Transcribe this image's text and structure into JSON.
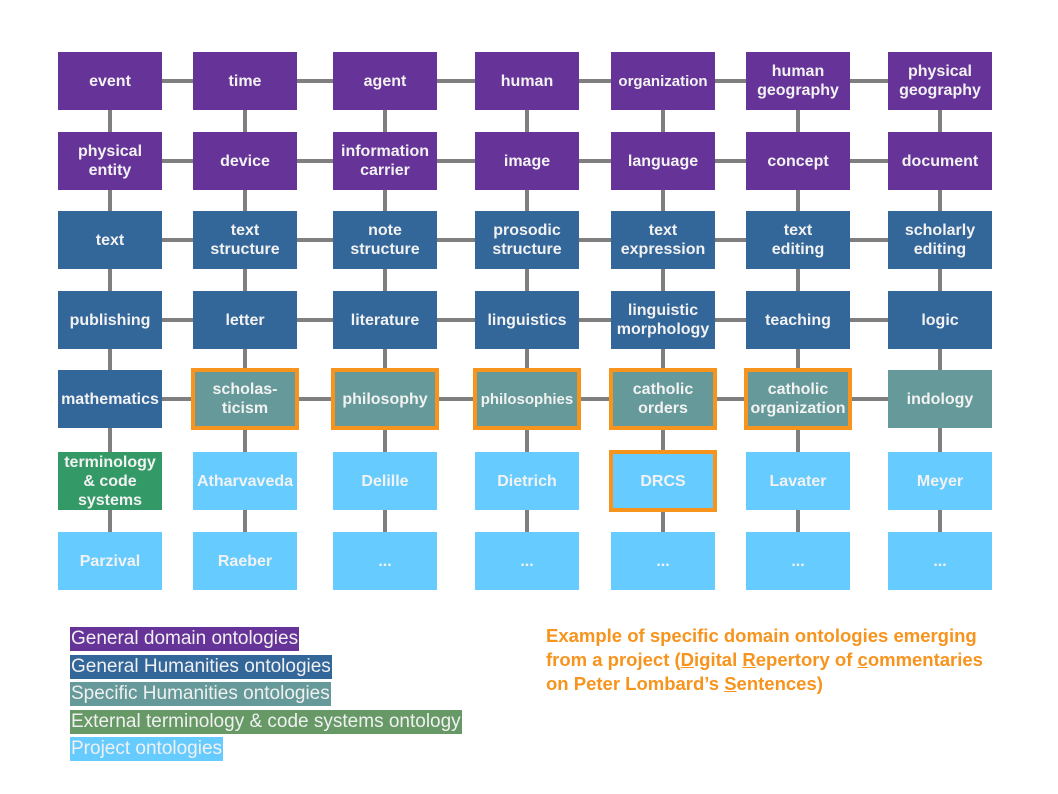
{
  "colors": {
    "general_domain": "#663399",
    "general_humanities": "#336699",
    "specific_humanities": "#669999",
    "external_terminology": "#339966",
    "project": "#66ccff",
    "highlight_border": "#f7941d",
    "connector": "#7f7f7f"
  },
  "grid": {
    "rows": [
      [
        {
          "label": "event",
          "category": "general_domain"
        },
        {
          "label": "time",
          "category": "general_domain"
        },
        {
          "label": "agent",
          "category": "general_domain"
        },
        {
          "label": "human",
          "category": "general_domain"
        },
        {
          "label": "organization",
          "category": "general_domain"
        },
        {
          "label": "human\ngeography",
          "category": "general_domain"
        },
        {
          "label": "physical\ngeography",
          "category": "general_domain"
        }
      ],
      [
        {
          "label": "physical\nentity",
          "category": "general_domain"
        },
        {
          "label": "device",
          "category": "general_domain"
        },
        {
          "label": "information\ncarrier",
          "category": "general_domain"
        },
        {
          "label": "image",
          "category": "general_domain"
        },
        {
          "label": "language",
          "category": "general_domain"
        },
        {
          "label": "concept",
          "category": "general_domain"
        },
        {
          "label": "document",
          "category": "general_domain"
        }
      ],
      [
        {
          "label": "text",
          "category": "general_humanities"
        },
        {
          "label": "text\nstructure",
          "category": "general_humanities"
        },
        {
          "label": "note\nstructure",
          "category": "general_humanities"
        },
        {
          "label": "prosodic\nstructure",
          "category": "general_humanities"
        },
        {
          "label": "text\nexpression",
          "category": "general_humanities"
        },
        {
          "label": "text\nediting",
          "category": "general_humanities"
        },
        {
          "label": "scholarly\nediting",
          "category": "general_humanities"
        }
      ],
      [
        {
          "label": "publishing",
          "category": "general_humanities"
        },
        {
          "label": "letter",
          "category": "general_humanities"
        },
        {
          "label": "literature",
          "category": "general_humanities"
        },
        {
          "label": "linguistics",
          "category": "general_humanities"
        },
        {
          "label": "linguistic\nmorphology",
          "category": "general_humanities"
        },
        {
          "label": "teaching",
          "category": "general_humanities"
        },
        {
          "label": "logic",
          "category": "general_humanities"
        }
      ],
      [
        {
          "label": "mathematics",
          "category": "general_humanities"
        },
        {
          "label": "scholas-\nticism",
          "category": "specific_humanities",
          "highlighted": true
        },
        {
          "label": "philosophy",
          "category": "specific_humanities",
          "highlighted": true
        },
        {
          "label": "philosophies",
          "category": "specific_humanities",
          "highlighted": true
        },
        {
          "label": "catholic\norders",
          "category": "specific_humanities",
          "highlighted": true
        },
        {
          "label": "catholic\norganization",
          "category": "specific_humanities",
          "highlighted": true
        },
        {
          "label": "indology",
          "category": "specific_humanities"
        }
      ],
      [
        {
          "label": "terminology\n& code\nsystems",
          "category": "external_terminology"
        },
        {
          "label": "Atharvaveda",
          "category": "project"
        },
        {
          "label": "Delille",
          "category": "project"
        },
        {
          "label": "Dietrich",
          "category": "project"
        },
        {
          "label": "DRCS",
          "category": "project",
          "highlighted": true
        },
        {
          "label": "Lavater",
          "category": "project"
        },
        {
          "label": "Meyer",
          "category": "project"
        }
      ],
      [
        {
          "label": "Parzival",
          "category": "project"
        },
        {
          "label": "Raeber",
          "category": "project"
        },
        {
          "label": "...",
          "category": "project"
        },
        {
          "label": "...",
          "category": "project"
        },
        {
          "label": "...",
          "category": "project"
        },
        {
          "label": "...",
          "category": "project"
        },
        {
          "label": "...",
          "category": "project"
        }
      ]
    ],
    "horizontal_links_rows": [
      0,
      1,
      2,
      3,
      4
    ]
  },
  "legend": [
    {
      "label": "General domain ontologies",
      "category": "general_domain",
      "color": "#663399"
    },
    {
      "label": "General Humanities ontologies",
      "category": "general_humanities",
      "color": "#336699"
    },
    {
      "label": "Specific Humanities ontologies",
      "category": "specific_humanities",
      "color": "#669999"
    },
    {
      "label": "External terminology & code systems ontology",
      "category": "external_terminology",
      "color": "#669966"
    },
    {
      "label": "Project ontologies",
      "category": "project",
      "color": "#66ccff"
    }
  ],
  "note": {
    "parts": [
      {
        "text": "Example of specific domain ontologies emerging from a project (",
        "u": false
      },
      {
        "text": "D",
        "u": true
      },
      {
        "text": "igital ",
        "u": false
      },
      {
        "text": "R",
        "u": true
      },
      {
        "text": "epertory of ",
        "u": false
      },
      {
        "text": "c",
        "u": true
      },
      {
        "text": "ommentaries on Peter Lombard’s ",
        "u": false
      },
      {
        "text": "S",
        "u": true
      },
      {
        "text": "entences)",
        "u": false
      }
    ]
  }
}
